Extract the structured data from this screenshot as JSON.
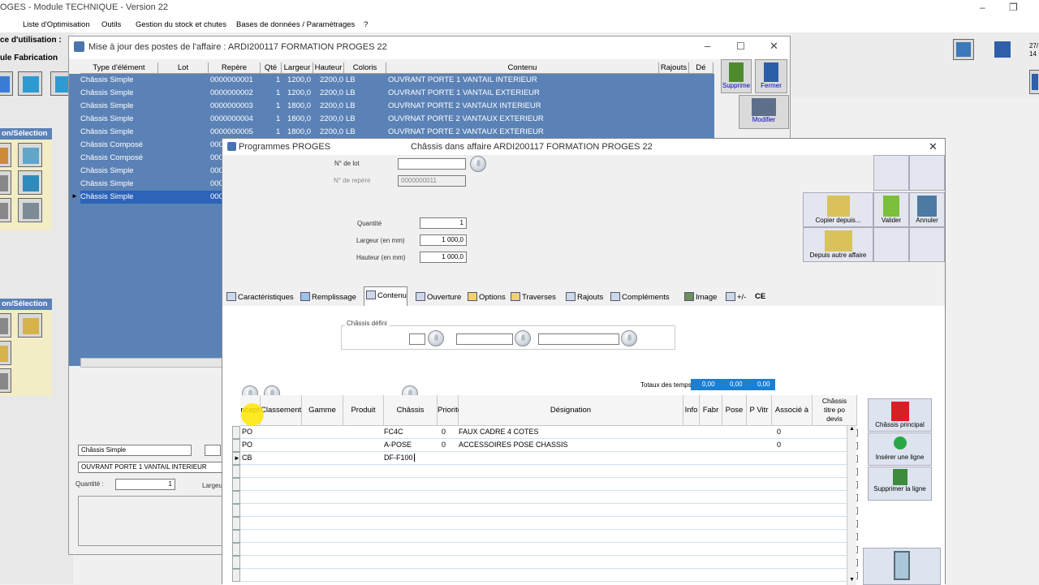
{
  "app": {
    "title": "OGES - Module TECHNIQUE - Version 22",
    "menu": [
      "Liste d'Optimisation",
      "Outils",
      "Gestion du stock et chutes",
      "Bases de données / Paramétrages",
      "?"
    ],
    "left_label_1": "ce d'utilisation :",
    "left_label_2": "ule Fabrication",
    "selection_header": "on/Sélection",
    "tray_text_1": "27/",
    "tray_text_2": "14"
  },
  "list_window": {
    "title": "Mise à jour des postes de l'affaire : ARDI200117 FORMATION PROGES 22",
    "columns": [
      "Type d'élément",
      "Lot",
      "Repère",
      "Qté",
      "Largeur",
      "Hauteur",
      "Coloris",
      "Contenu",
      "Rajouts",
      "Dé"
    ],
    "rows": [
      {
        "type": "Châssis Simple",
        "lot": "",
        "repere": "0000000001",
        "qte": "1",
        "largeur": "1200,0",
        "hauteur": "2200,0",
        "coloris": "LB",
        "contenu": "OUVRANT PORTE 1 VANTAIL INTERIEUR"
      },
      {
        "type": "Châssis Simple",
        "lot": "",
        "repere": "0000000002",
        "qte": "1",
        "largeur": "1200,0",
        "hauteur": "2200,0",
        "coloris": "LB",
        "contenu": "OUVRANT PORTE 1 VANTAIL EXTERIEUR"
      },
      {
        "type": "Châssis Simple",
        "lot": "",
        "repere": "0000000003",
        "qte": "1",
        "largeur": "1800,0",
        "hauteur": "2200,0",
        "coloris": "LB",
        "contenu": "OUVRNAT PORTE 2 VANTAUX INTERIEUR"
      },
      {
        "type": "Châssis Simple",
        "lot": "",
        "repere": "0000000004",
        "qte": "1",
        "largeur": "1800,0",
        "hauteur": "2200,0",
        "coloris": "LB",
        "contenu": "OUVRNAT PORTE 2 VANTAUX EXTERIEUR"
      },
      {
        "type": "Châssis Simple",
        "lot": "",
        "repere": "0000000005",
        "qte": "1",
        "largeur": "1800,0",
        "hauteur": "2200,0",
        "coloris": "LB",
        "contenu": "OUVRNAT PORTE 2 VANTAUX EXTERIEUR"
      },
      {
        "type": "Châssis Composé",
        "lot": "",
        "repere": "000",
        "qte": "",
        "largeur": "",
        "hauteur": "",
        "coloris": "",
        "contenu": ""
      },
      {
        "type": "Châssis Composé",
        "lot": "",
        "repere": "000",
        "qte": "",
        "largeur": "",
        "hauteur": "",
        "coloris": "",
        "contenu": ""
      },
      {
        "type": "Châssis Simple",
        "lot": "",
        "repere": "000",
        "qte": "",
        "largeur": "",
        "hauteur": "",
        "coloris": "",
        "contenu": ""
      },
      {
        "type": "Châssis Simple",
        "lot": "",
        "repere": "000",
        "qte": "",
        "largeur": "",
        "hauteur": "",
        "coloris": "",
        "contenu": ""
      },
      {
        "type": "Châssis Simple",
        "lot": "",
        "repere": "000",
        "qte": "",
        "largeur": "",
        "hauteur": "",
        "coloris": "",
        "contenu": ""
      }
    ],
    "buttons": {
      "supprime": "Supprime",
      "fermer": "Fermer",
      "modifier": "Modifier"
    },
    "detail": {
      "type": "Châssis Simple",
      "contenu": "OUVRANT PORTE 1 VANTAIL INTERIEUR",
      "quantite_label": "Quantité :",
      "quantite": "1",
      "largeur_label": "Largeur"
    }
  },
  "dialog": {
    "app_name": "Programmes PROGES",
    "title": "Châssis dans affaire ARDI200117 FORMATION PROGES 22",
    "fields": {
      "lot_label": "N° de lot",
      "lot_value": "",
      "repere_label": "N° de repère",
      "repere_value": "0000000011",
      "quantite_label": "Quantité",
      "quantite_value": "1",
      "largeur_label": "Largeur (en mm)",
      "largeur_value": "1 000,0",
      "hauteur_label": "Hauteur (en mm)",
      "hauteur_value": "1 000,0"
    },
    "buttons": {
      "copier": "Copier depuis...",
      "valider": "Valider",
      "annuler": "Annuler",
      "depuis_affaire": "Depuis autre affaire",
      "chassis_principal": "Châssis principal",
      "inserer": "Insérer une ligne",
      "supprimer": "Supprimer la ligne"
    },
    "tabs": [
      "Caractéristiques",
      "Remplissage",
      "Contenu",
      "Ouverture",
      "Options",
      "Traverses",
      "Rajouts",
      "Compléments",
      "Image",
      "+/-",
      "CE"
    ],
    "chassis_defini_label": "Châssis défini",
    "totaux_label": "Totaux des temps",
    "totaux": [
      "0,00",
      "0,00",
      "0,00"
    ],
    "grid_columns": [
      "ncept",
      "Classement",
      "Gamme",
      "Produit",
      "Châssis",
      "Priorité",
      "Désignation",
      "Info",
      "Fabr",
      "Pose",
      "P Vitr",
      "Associé à",
      "Châssis titre po devis"
    ],
    "grid_rows": [
      {
        "concept": "PO",
        "chassis": "FC4C",
        "priorite": "0",
        "designation": "FAUX CADRE 4 COTES",
        "associe": "0"
      },
      {
        "concept": "PO",
        "chassis": "A-POSE",
        "priorite": "0",
        "designation": "ACCESSOIRES POSE CHASSIS",
        "associe": "0"
      },
      {
        "concept": "CB",
        "chassis": "DF-F100",
        "priorite": "",
        "designation": "",
        "associe": ""
      }
    ]
  }
}
